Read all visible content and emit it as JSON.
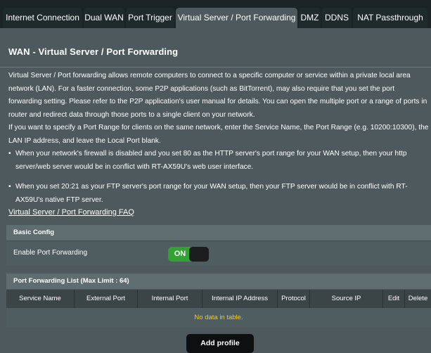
{
  "tabs": [
    {
      "label": "Internet Connection",
      "active": false
    },
    {
      "label": "Dual WAN",
      "active": false
    },
    {
      "label": "Port Trigger",
      "active": false
    },
    {
      "label": "Virtual Server / Port Forwarding",
      "active": true
    },
    {
      "label": "DMZ",
      "active": false
    },
    {
      "label": "DDNS",
      "active": false
    },
    {
      "label": "NAT Passthrough",
      "active": false
    }
  ],
  "page": {
    "title": "WAN - Virtual Server / Port Forwarding",
    "description_1": "Virtual Server / Port forwarding allows remote computers to connect to a specific computer or service within a private local area network (LAN). For a faster connection, some P2P applications (such as BitTorrent), may also require that you set the port forwarding setting. Please refer to the P2P application's user manual for details. You can open the multiple port or a range of ports in router and redirect data through those ports to a single client on your network.",
    "description_2": "If you want to specify a Port Range for clients on the same network, enter the Service Name, the Port Range (e.g. 10200:10300), the LAN IP address, and leave the Local Port blank.",
    "bullet_dot": "•",
    "bullet_1": "When your network's firewall is disabled and you set 80 as the HTTP server's port range for your WAN setup, then your http server/web server would be in conflict with RT-AX59U's web user interface.",
    "bullet_2": "When you set 20:21 as your FTP server's port range for your WAN setup, then your FTP server would be in conflict with RT-AX59U's native FTP server.",
    "faq_link": "Virtual Server / Port Forwarding FAQ"
  },
  "basic_config": {
    "header": "Basic Config",
    "enable_label": "Enable Port Forwarding",
    "toggle_text": "ON",
    "enabled": true
  },
  "port_list": {
    "header": "Port Forwarding List (Max Limit : 64)",
    "columns": [
      "Service Name",
      "External Port",
      "Internal Port",
      "Internal IP Address",
      "Protocol",
      "Source IP",
      "Edit",
      "Delete"
    ],
    "empty_text": "No data in table."
  },
  "add_button": "Add profile",
  "colors": {
    "background": "#4d595d",
    "tab_bar": "#1c2326",
    "toggle_on": "#31a233",
    "empty_text": "#ffcc00"
  }
}
